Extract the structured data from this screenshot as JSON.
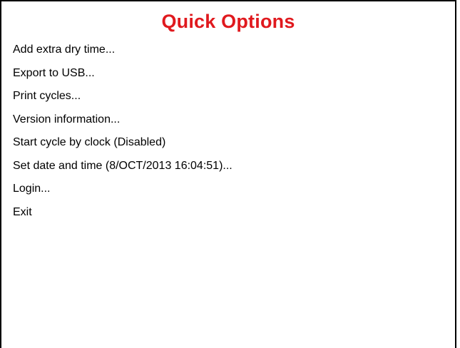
{
  "header": {
    "title": "Quick Options",
    "title_color": "#e0191e"
  },
  "menu": {
    "items": [
      {
        "label": "Add extra dry time..."
      },
      {
        "label": "Export to USB..."
      },
      {
        "label": "Print cycles..."
      },
      {
        "label": "Version information..."
      },
      {
        "label": "Start cycle by clock (Disabled)"
      },
      {
        "label": "Set date and time (8/OCT/2013 16:04:51)..."
      },
      {
        "label": "Login..."
      },
      {
        "label": "Exit"
      }
    ]
  }
}
